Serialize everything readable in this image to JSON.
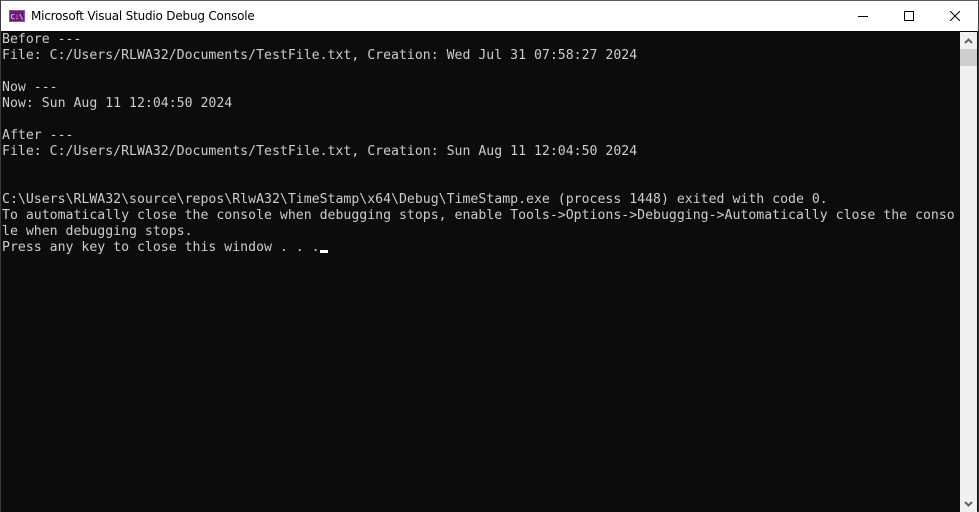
{
  "window": {
    "title": "Microsoft Visual Studio Debug Console",
    "app_icon_text": "C:\\",
    "caption_buttons": [
      "minimize",
      "maximize",
      "close"
    ]
  },
  "console": {
    "lines": [
      "Before ---",
      "File: C:/Users/RLWA32/Documents/TestFile.txt, Creation: Wed Jul 31 07:58:27 2024",
      "",
      "Now ---",
      "Now: Sun Aug 11 12:04:50 2024",
      "",
      "After ---",
      "File: C:/Users/RLWA32/Documents/TestFile.txt, Creation: Sun Aug 11 12:04:50 2024",
      "",
      "",
      "C:\\Users\\RLWA32\\source\\repos\\RlwA32\\TimeStamp\\x64\\Debug\\TimeStamp.exe (process 1448) exited with code 0.",
      "To automatically close the console when debugging stops, enable Tools->Options->Debugging->Automatically close the conso",
      "le when debugging stops.",
      "Press any key to close this window . . ."
    ],
    "colors": {
      "background": "#0c0c0c",
      "foreground": "#cccccc"
    }
  }
}
